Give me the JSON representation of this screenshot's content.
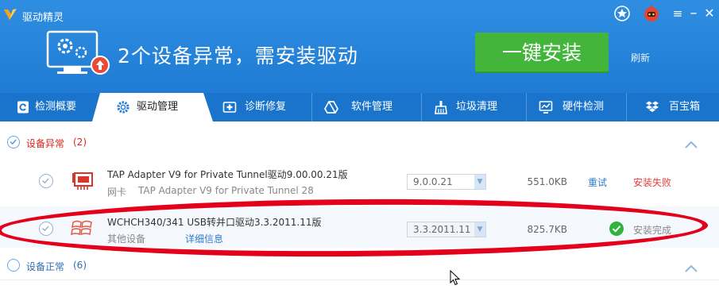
{
  "window": {
    "title": "驱动精灵"
  },
  "hero": {
    "message": "2个设备异常，需安装驱动",
    "install_button": "一键安装",
    "refresh_link": "刷新"
  },
  "tabs": [
    {
      "label": "检测概要",
      "icon": "refresh-doc-icon"
    },
    {
      "label": "驱动管理",
      "icon": "gear-icon",
      "active": true
    },
    {
      "label": "诊断修复",
      "icon": "medical-cross-icon"
    },
    {
      "label": "软件管理",
      "icon": "drive-triangle-icon"
    },
    {
      "label": "垃圾清理",
      "icon": "broom-icon"
    },
    {
      "label": "硬件检测",
      "icon": "chart-monitor-icon"
    },
    {
      "label": "百宝箱",
      "icon": "dropbox-icon"
    }
  ],
  "groups": {
    "abnormal": {
      "title": "设备异常",
      "count": "(2)"
    },
    "normal": {
      "title": "设备正常",
      "count": "(6)"
    }
  },
  "devices": [
    {
      "name": "TAP Adapter V9 for Private Tunnel驱动9.00.00.21版",
      "category": "网卡",
      "detail": "TAP Adapter V9 for Private Tunnel   28",
      "version": "9.0.0.21",
      "size": "551.0KB",
      "retry": "重试",
      "status": "安装失败",
      "icon": "network-card-icon"
    },
    {
      "name": "WCHCH340/341 USB转并口驱动3.3.2011.11版",
      "category": "其他设备",
      "detail_link": "详细信息",
      "version": "3.3.2011.11",
      "size": "825.7KB",
      "status": "安装完成",
      "icon": "windows-flag-icon"
    }
  ],
  "colors": {
    "header_blue": "#2a88dd",
    "install_green": "#43b53a",
    "annotation_red": "#e4001a",
    "fail_red": "#e04040"
  }
}
